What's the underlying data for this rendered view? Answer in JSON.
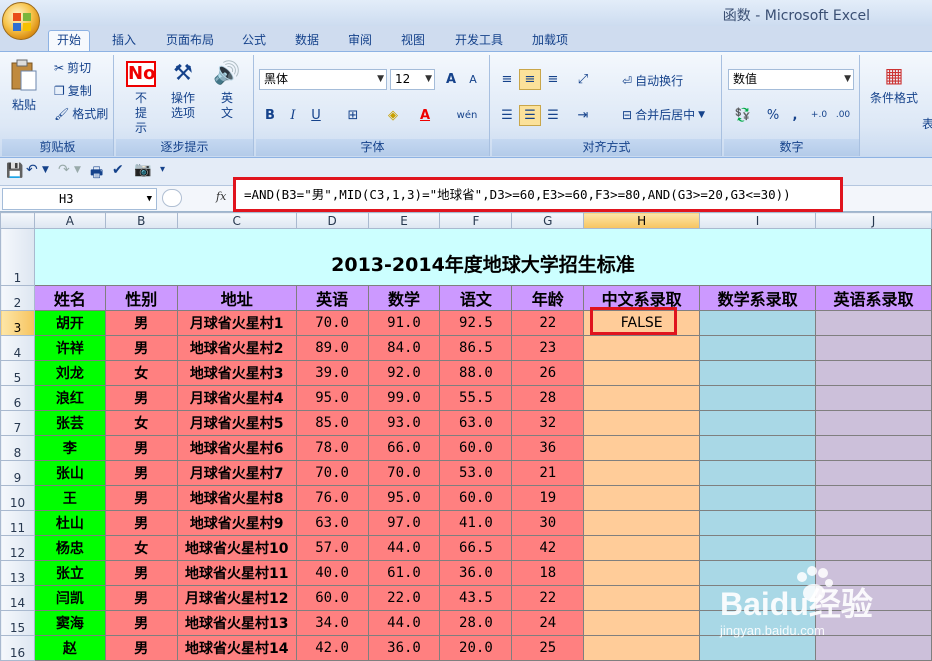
{
  "window": {
    "title": "函数 - Microsoft Excel"
  },
  "ribbon": {
    "tabs": [
      "开始",
      "插入",
      "页面布局",
      "公式",
      "数据",
      "审阅",
      "视图",
      "开发工具",
      "加载项"
    ],
    "clipboard": {
      "paste": "粘贴",
      "cut": "剪切",
      "copy": "复制",
      "format_painter": "格式刷",
      "label": "剪贴板"
    },
    "wizard": {
      "no_tips": "不提示",
      "op_options": "操作选项",
      "english": "英文",
      "label": "逐步提示"
    },
    "font": {
      "name": "黑体",
      "size": "12",
      "label": "字体",
      "bold": "B",
      "italic": "I",
      "underline": "U",
      "font_color": "A",
      "grow": "A",
      "shrink": "A",
      "phonetic": "wén"
    },
    "alignment": {
      "wrap_text": "自动换行",
      "merge_center": "合并后居中",
      "label": "对齐方式"
    },
    "number": {
      "format": "数值",
      "label": "数字",
      "percent": "%",
      "comma": ",",
      "inc_decimal": "+.0",
      "dec_decimal": ".00"
    },
    "styles": {
      "conditional": "条件格式",
      "table": "表"
    }
  },
  "formula_bar": {
    "name_box": "H3",
    "fx": "fx",
    "formula": "=AND(B3=\"男\",MID(C3,1,3)=\"地球省\",D3>=60,E3>=60,F3>=80,AND(G3>=20,G3<=30))"
  },
  "sheet": {
    "columns": [
      "A",
      "B",
      "C",
      "D",
      "E",
      "F",
      "G",
      "H",
      "I",
      "J"
    ],
    "title": "2013-2014年度地球大学招生标准",
    "headers": [
      "姓名",
      "性别",
      "地址",
      "英语",
      "数学",
      "语文",
      "年龄",
      "中文系录取",
      "数学系录取",
      "英语系录取"
    ],
    "rows": [
      {
        "row": "3",
        "cells": [
          "胡开",
          "男",
          "月球省火星村1",
          "70.0",
          "91.0",
          "92.5",
          "22",
          "FALSE",
          "",
          ""
        ]
      },
      {
        "row": "4",
        "cells": [
          "许祥",
          "男",
          "地球省火星村2",
          "89.0",
          "84.0",
          "86.5",
          "23",
          "",
          "",
          ""
        ]
      },
      {
        "row": "5",
        "cells": [
          "刘龙",
          "女",
          "地球省火星村3",
          "39.0",
          "92.0",
          "88.0",
          "26",
          "",
          "",
          ""
        ]
      },
      {
        "row": "6",
        "cells": [
          "浪红",
          "男",
          "月球省火星村4",
          "95.0",
          "99.0",
          "55.5",
          "28",
          "",
          "",
          ""
        ]
      },
      {
        "row": "7",
        "cells": [
          "张芸",
          "女",
          "月球省火星村5",
          "85.0",
          "93.0",
          "63.0",
          "32",
          "",
          "",
          ""
        ]
      },
      {
        "row": "8",
        "cells": [
          "李",
          "男",
          "地球省火星村6",
          "78.0",
          "66.0",
          "60.0",
          "36",
          "",
          "",
          ""
        ]
      },
      {
        "row": "9",
        "cells": [
          "张山",
          "男",
          "月球省火星村7",
          "70.0",
          "70.0",
          "53.0",
          "21",
          "",
          "",
          ""
        ]
      },
      {
        "row": "10",
        "cells": [
          "王",
          "男",
          "地球省火星村8",
          "76.0",
          "95.0",
          "60.0",
          "19",
          "",
          "",
          ""
        ]
      },
      {
        "row": "11",
        "cells": [
          "杜山",
          "男",
          "地球省火星村9",
          "63.0",
          "97.0",
          "41.0",
          "30",
          "",
          "",
          ""
        ]
      },
      {
        "row": "12",
        "cells": [
          "杨忠",
          "女",
          "地球省火星村10",
          "57.0",
          "44.0",
          "66.5",
          "42",
          "",
          "",
          ""
        ]
      },
      {
        "row": "13",
        "cells": [
          "张立",
          "男",
          "地球省火星村11",
          "40.0",
          "61.0",
          "36.0",
          "18",
          "",
          "",
          ""
        ]
      },
      {
        "row": "14",
        "cells": [
          "闫凯",
          "男",
          "月球省火星村12",
          "60.0",
          "22.0",
          "43.5",
          "22",
          "",
          "",
          ""
        ]
      },
      {
        "row": "15",
        "cells": [
          "窦海",
          "男",
          "地球省火星村13",
          "34.0",
          "44.0",
          "28.0",
          "24",
          "",
          "",
          ""
        ]
      },
      {
        "row": "16",
        "cells": [
          "赵",
          "男",
          "地球省火星村14",
          "42.0",
          "36.0",
          "20.0",
          "25",
          "",
          "",
          ""
        ]
      }
    ]
  },
  "watermark": {
    "brand": "Baidu经验",
    "url": "jingyan.baidu.com"
  },
  "colors": {
    "highlight_box": "#e0141e",
    "name_col": "#00ff00",
    "data_cols": "#ff8080",
    "header_row": "#cc99ff",
    "title_row": "#ccffff"
  }
}
